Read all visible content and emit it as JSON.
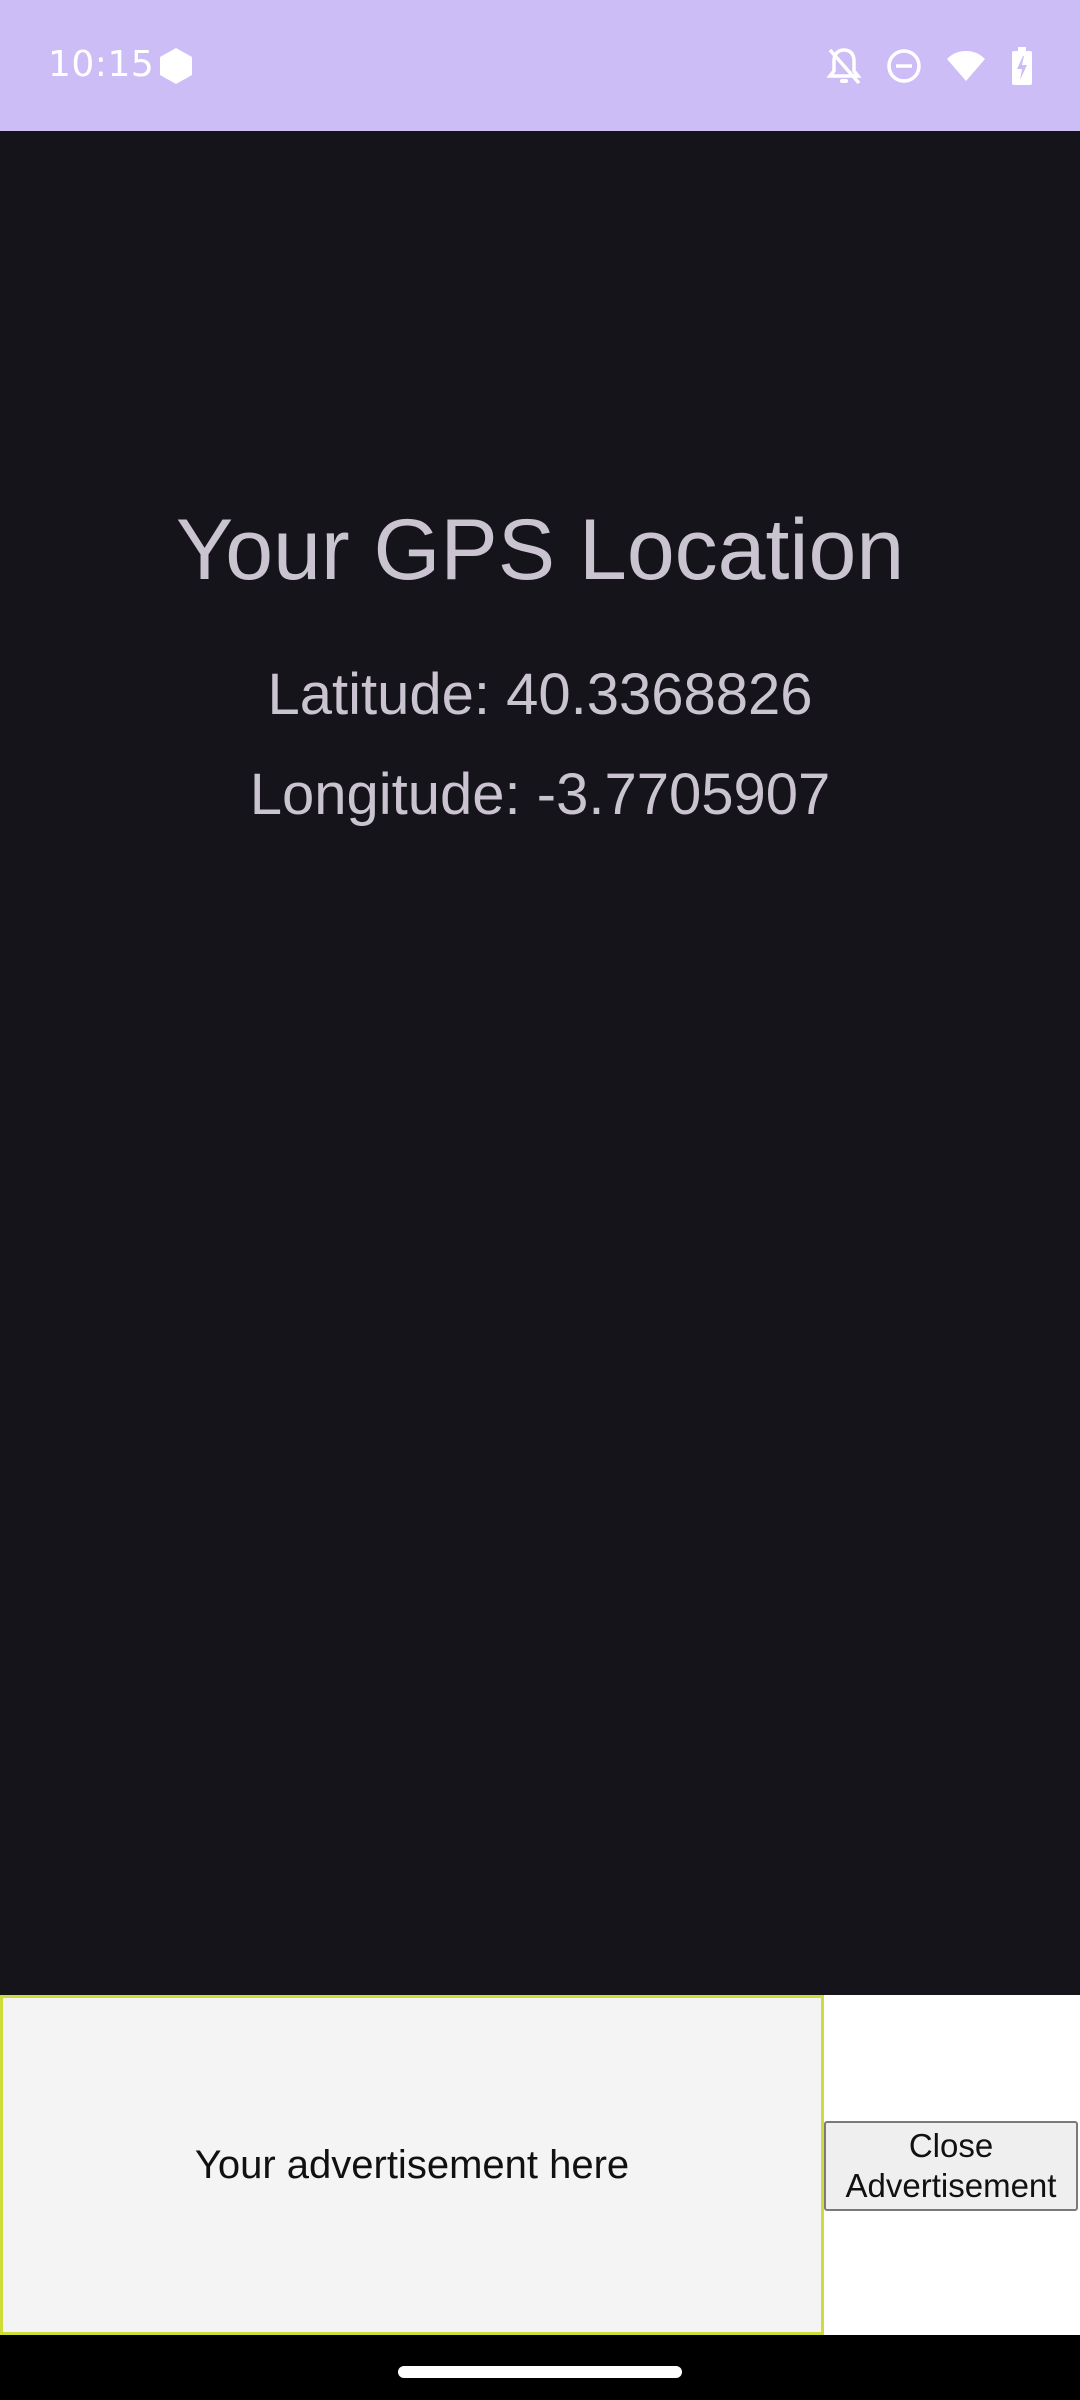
{
  "status_bar": {
    "time": "10:15",
    "icons": [
      "app-hexagon-icon",
      "notifications-off-icon",
      "do-not-disturb-icon",
      "wifi-icon",
      "battery-charging-icon"
    ]
  },
  "main": {
    "title": "Your GPS Location",
    "latitude_text": "Latitude: 40.3368826",
    "longitude_text": "Longitude: -3.7705907"
  },
  "ad": {
    "text": "Your advertisement here",
    "close_button_label": "Close Advertisement"
  },
  "colors": {
    "status_bar_bg": "#cdbdf7",
    "background": "#16141b",
    "text": "#cac4d0",
    "ad_border": "#cddc39"
  }
}
